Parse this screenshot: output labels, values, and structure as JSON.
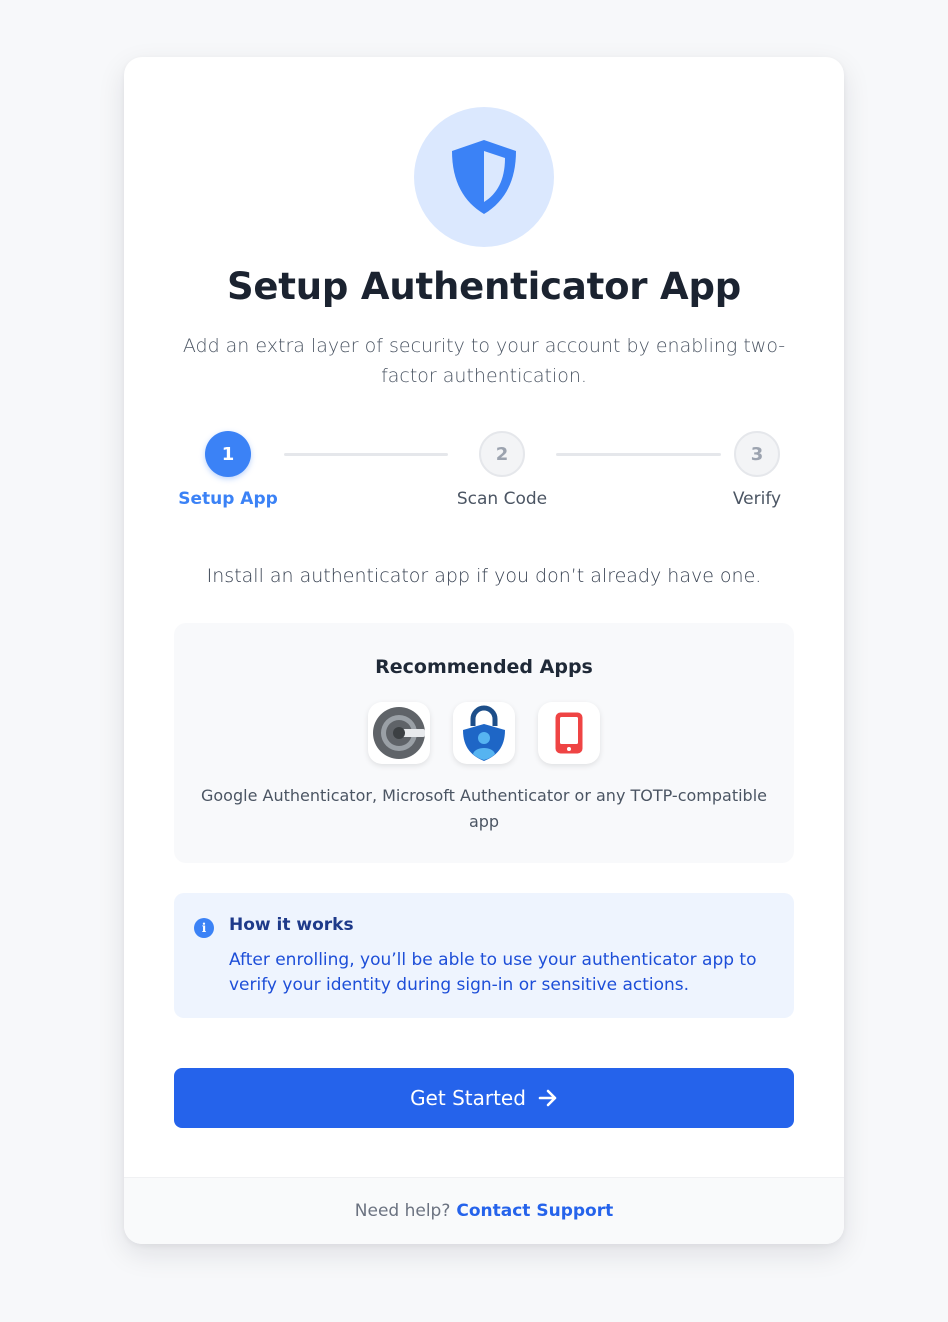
{
  "header": {
    "icon": "shield-icon",
    "title": "Setup Authenticator App",
    "subtitle": "Add an extra layer of security to your account by enabling two-factor authentication."
  },
  "steps": [
    {
      "number": "1",
      "label": "Setup App",
      "state": "active"
    },
    {
      "number": "2",
      "label": "Scan Code",
      "state": "inactive"
    },
    {
      "number": "3",
      "label": "Verify",
      "state": "inactive"
    }
  ],
  "instruction": "Install an authenticator app if you don’t already have one.",
  "recommended": {
    "heading": "Recommended Apps",
    "apps": [
      {
        "name": "google-authenticator-icon"
      },
      {
        "name": "microsoft-authenticator-icon"
      },
      {
        "name": "phone-icon"
      }
    ],
    "caption": "Google Authenticator, Microsoft Authenticator or any TOTP-compatible app"
  },
  "info": {
    "icon": "info-icon",
    "icon_glyph": "i",
    "title": "How it works",
    "text": "After enrolling, you’ll be able to use your authenticator app to verify your identity during sign-in or sensitive actions."
  },
  "cta": {
    "label": "Get Started",
    "icon": "arrow-right-icon"
  },
  "footer": {
    "prompt": "Need help?",
    "link": "Contact Support"
  },
  "colors": {
    "primary": "#2563eb",
    "accent": "#3b82f6",
    "hero_bg": "#dbe8fe",
    "info_bg": "#eef4fe"
  }
}
